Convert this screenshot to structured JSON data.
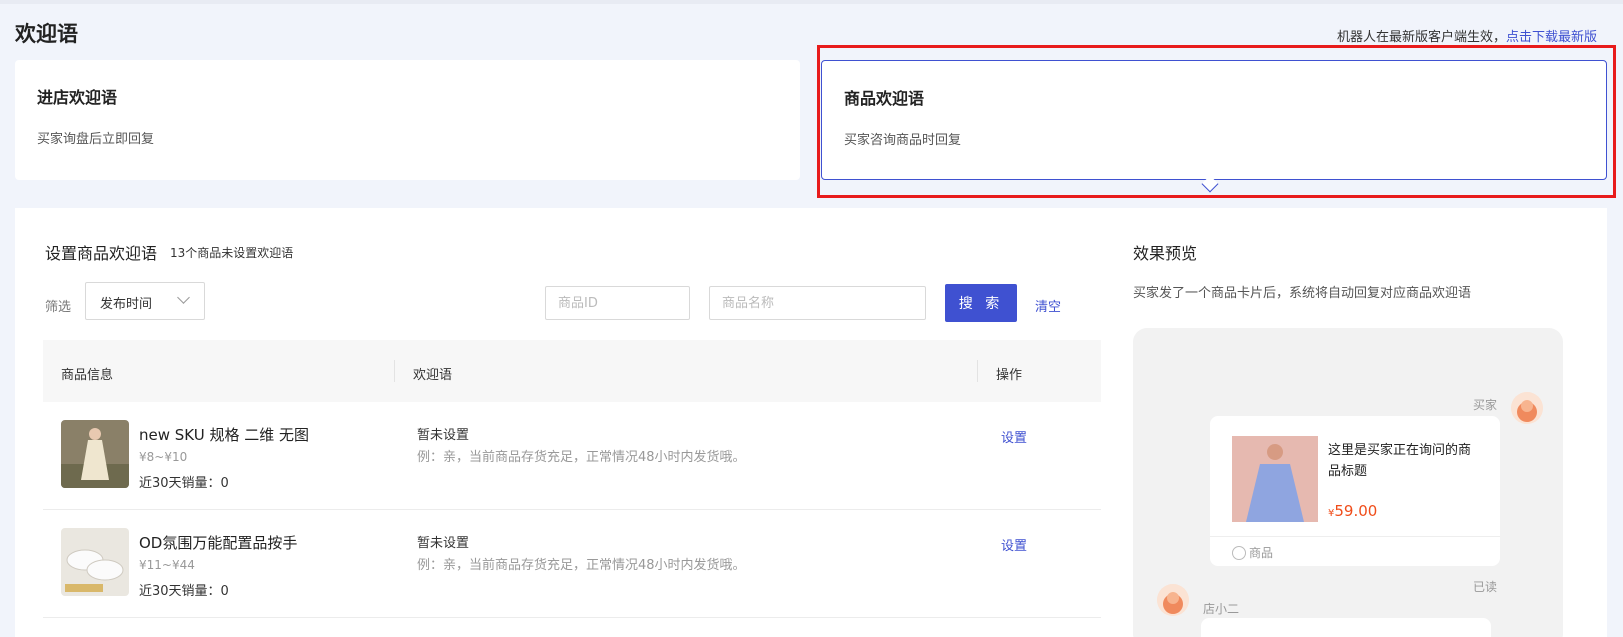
{
  "page": {
    "title": "欢迎语"
  },
  "notice": {
    "text": "机器人在最新版客户端生效，",
    "link": "点击下载最新版"
  },
  "cards": [
    {
      "title": "进店欢迎语",
      "desc": "买家询盘后立即回复"
    },
    {
      "title": "商品欢迎语",
      "desc": "买家咨询商品时回复"
    }
  ],
  "section": {
    "title": "设置商品欢迎语",
    "subtitle": "13个商品未设置欢迎语"
  },
  "filters": {
    "label": "筛选",
    "select_value": "发布时间",
    "id_placeholder": "商品ID",
    "name_placeholder": "商品名称",
    "search_label": "搜 索",
    "clear_label": "清空"
  },
  "table": {
    "headers": [
      "商品信息",
      "欢迎语",
      "操作"
    ],
    "rows": [
      {
        "name": "new SKU 规格 二维 无图",
        "price": "¥8~¥10",
        "sales": "近30天销量：0",
        "status": "暂未设置",
        "example": "例：亲，当前商品存货充足，正常情况48小时内发货哦。",
        "action": "设置"
      },
      {
        "name": "OD氛围万能配置品按手",
        "price": "¥11~¥44",
        "sales": "近30天销量：0",
        "status": "暂未设置",
        "example": "例：亲，当前商品存货充足，正常情况48小时内发货哦。",
        "action": "设置"
      }
    ]
  },
  "preview": {
    "title": "效果预览",
    "desc": "买家发了一个商品卡片后，系统将自动回复对应商品欢迎语",
    "buyer_label": "买家",
    "card_title": "这里是买家正在询问的商品标题",
    "card_price_symbol": "¥",
    "card_price": "59.00",
    "card_tag": "商品",
    "read_label": "已读",
    "seller_label": "店小二"
  },
  "colors": {
    "accent": "#3f51d1",
    "highlight": "#e81b1b",
    "price": "#f04d1a"
  }
}
